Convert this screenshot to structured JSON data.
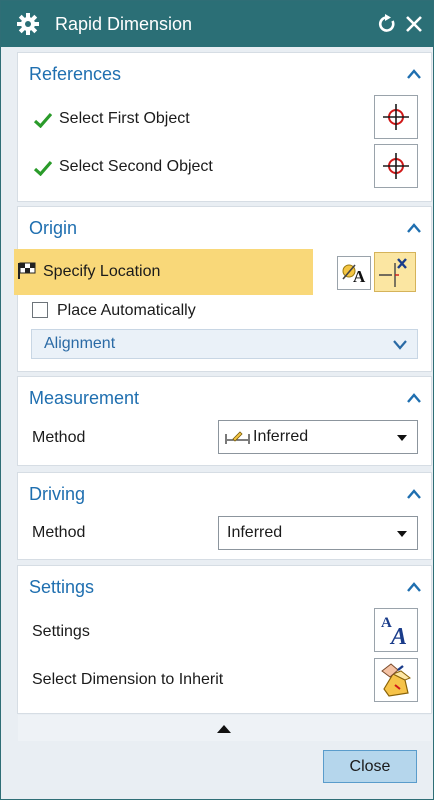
{
  "window": {
    "title": "Rapid Dimension"
  },
  "icons": {
    "settings": "gear-icon",
    "reset": "reset-icon",
    "close": "close-icon",
    "collapse": "chevron-up-icon",
    "expand": "chevron-down-icon",
    "check": "checkmark-icon",
    "crosshair": "crosshair-icon",
    "flag": "checkered-flag-icon"
  },
  "colors": {
    "titlebar": "#2b6f76",
    "section_title": "#1f6fb0",
    "highlight": "#f9d879",
    "check_green": "#2a9b2a",
    "close_button": "#b5d6ec"
  },
  "references": {
    "title": "References",
    "first": "Select First Object",
    "second": "Select Second Object"
  },
  "origin": {
    "title": "Origin",
    "specify_location": "Specify Location",
    "place_automatically": "Place Automatically",
    "place_automatically_checked": false,
    "alignment": "Alignment"
  },
  "measurement": {
    "title": "Measurement",
    "method_label": "Method",
    "method_value": "Inferred"
  },
  "driving": {
    "title": "Driving",
    "method_label": "Method",
    "method_value": "Inferred"
  },
  "settings": {
    "title": "Settings",
    "settings_label": "Settings",
    "inherit_label": "Select Dimension to Inherit"
  },
  "footer": {
    "close_label": "Close"
  }
}
